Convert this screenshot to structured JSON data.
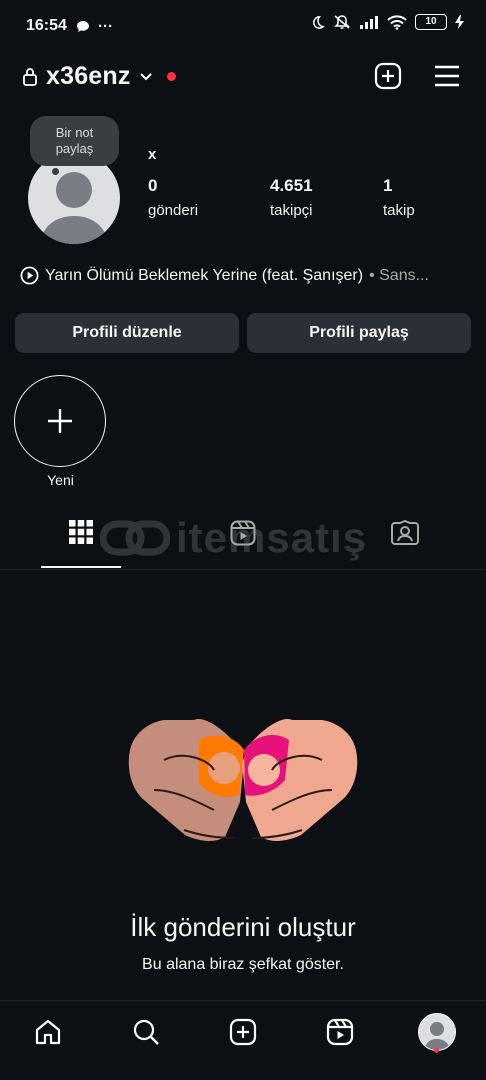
{
  "status_bar": {
    "time": "16:54",
    "more": "···",
    "battery": "10",
    "icons": [
      "chat-bubble-icon",
      "moon-icon",
      "mute-icon",
      "signal-icon",
      "wifi-icon",
      "charging-icon"
    ]
  },
  "header": {
    "username": "x36enz",
    "lock_icon": "lock-icon",
    "dropdown_icon": "chevron-down-icon",
    "new_post_icon": "plus-square-icon",
    "menu_icon": "hamburger-menu-icon"
  },
  "profile": {
    "note": {
      "line1": "Bir not",
      "line2": "paylaş"
    },
    "display_name": "x",
    "stats": [
      {
        "number": "0",
        "label": "gönderi"
      },
      {
        "number": "4.651",
        "label": "takipçi"
      },
      {
        "number": "1",
        "label": "takip"
      }
    ],
    "music": {
      "song": "Yarın Ölümü Beklemek Yerine (feat. Şanışer)",
      "artist": "• Sans..."
    },
    "buttons": {
      "edit": "Profili düzenle",
      "share": "Profili paylaş"
    }
  },
  "highlights": {
    "new_label": "Yeni"
  },
  "tabs": [
    {
      "name": "grid-icon",
      "selected": true
    },
    {
      "name": "reels-icon",
      "selected": false
    },
    {
      "name": "tagged-icon",
      "selected": false
    }
  ],
  "watermark": {
    "brand": "itemsatış"
  },
  "empty_state": {
    "title": "İlk gönderini oluştur",
    "subtitle": "Bu alana biraz şefkat göster."
  },
  "bottom_nav": [
    "home-icon",
    "search-icon",
    "create-icon",
    "reels-icon",
    "profile-avatar"
  ],
  "colors": {
    "background": "#0c1014",
    "button": "#2b3036",
    "notification": "#ff3040"
  }
}
